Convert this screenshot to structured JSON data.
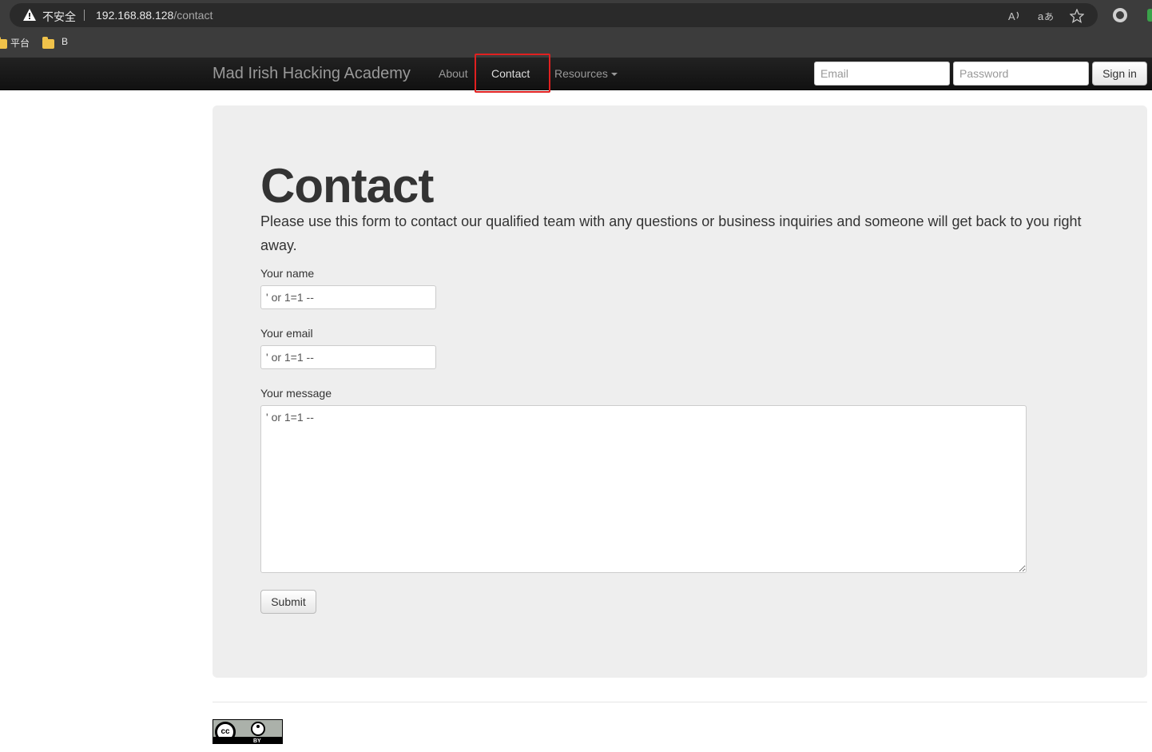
{
  "browser": {
    "insecure_label": "不安全",
    "url_host": "192.168.88.128",
    "url_path": "/contact",
    "bookmarks": [
      {
        "label": "平台"
      },
      {
        "label": "B"
      }
    ],
    "icons": [
      "warning-icon",
      "read-aloud-icon",
      "translate-icon",
      "favorite-star-icon",
      "extension-icon"
    ]
  },
  "navbar": {
    "brand": "Mad Irish Hacking Academy",
    "links": [
      {
        "label": "About"
      },
      {
        "label": "Contact",
        "active": true
      },
      {
        "label": "Resources"
      }
    ],
    "email_placeholder": "Email",
    "password_placeholder": "Password",
    "signin_label": "Sign in"
  },
  "main": {
    "title": "Contact",
    "lead": "Please use this form to contact our qualified team with any questions or business inquiries and someone will get back to you right away.",
    "form": {
      "name_label": "Your name",
      "name_value": "' or 1=1 --",
      "email_label": "Your email",
      "email_value": "' or 1=1 --",
      "message_label": "Your message",
      "message_value": "' or 1=1 --",
      "submit_label": "Submit"
    }
  },
  "footer": {
    "license_badge": "CC BY",
    "license_badge_by": "BY"
  },
  "colors": {
    "navbar_bg": "#1b1b1b",
    "hero_bg": "#eeeeee",
    "highlight_box": "#e02020"
  }
}
